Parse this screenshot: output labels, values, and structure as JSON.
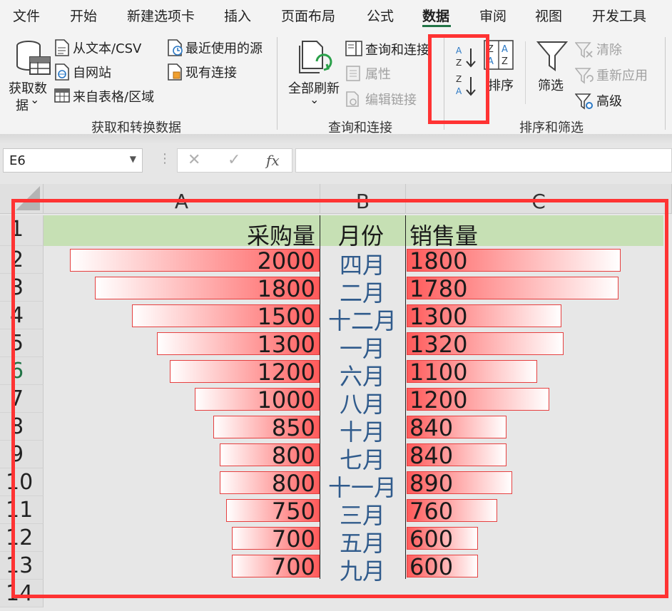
{
  "tabs": [
    "文件",
    "开始",
    "新建选项卡",
    "插入",
    "页面布局",
    "公式",
    "数据",
    "审阅",
    "视图",
    "开发工具"
  ],
  "ribbon": {
    "get_data": {
      "line1": "获取数",
      "line2": "据",
      "arrow": "⌄"
    },
    "from_text_csv": "从文本/CSV",
    "from_web": "自网站",
    "from_table": "来自表格/区域",
    "recent_sources": "最近使用的源",
    "existing_connections": "现有连接",
    "group1_label": "获取和转换数据",
    "refresh_all": "全部刷新",
    "refresh_arrow": "⌄",
    "queries_connections": "查询和连接",
    "properties": "属性",
    "edit_links": "编辑链接",
    "group2_label": "查询和连接",
    "sort": "排序",
    "filter": "筛选",
    "clear": "清除",
    "reapply": "重新应用",
    "advanced": "高级",
    "group3_label": "排序和筛选"
  },
  "formula_bar": {
    "name_box": "E6",
    "cancel": "✕",
    "enter": "✓",
    "fx": "fx",
    "value": ""
  },
  "sheet": {
    "columns": [
      "A",
      "B",
      "C"
    ],
    "header_row": {
      "a": "采购量",
      "b": "月份",
      "c": "销售量"
    },
    "row_numbers": [
      "1",
      "2",
      "3",
      "4",
      "5",
      "6",
      "7",
      "8",
      "9",
      "10",
      "11",
      "12",
      "13",
      "14"
    ],
    "selected_row": "6",
    "rows": [
      {
        "a": 2000,
        "b": "四月",
        "c": 1800
      },
      {
        "a": 1800,
        "b": "二月",
        "c": 1780
      },
      {
        "a": 1500,
        "b": "十二月",
        "c": 1300
      },
      {
        "a": 1300,
        "b": "一月",
        "c": 1320
      },
      {
        "a": 1200,
        "b": "六月",
        "c": 1100
      },
      {
        "a": 1000,
        "b": "八月",
        "c": 1200
      },
      {
        "a": 850,
        "b": "十月",
        "c": 840
      },
      {
        "a": 800,
        "b": "七月",
        "c": 840
      },
      {
        "a": 800,
        "b": "十一月",
        "c": 890
      },
      {
        "a": 750,
        "b": "三月",
        "c": 760
      },
      {
        "a": 700,
        "b": "五月",
        "c": 600
      },
      {
        "a": 700,
        "b": "九月",
        "c": 600
      }
    ]
  },
  "colors": {
    "highlight": "#ff3333",
    "header_fill": "#c6e0b4",
    "accent": "#217346",
    "month_text": "#305b8c",
    "bar_red": "#ff5a5a"
  }
}
